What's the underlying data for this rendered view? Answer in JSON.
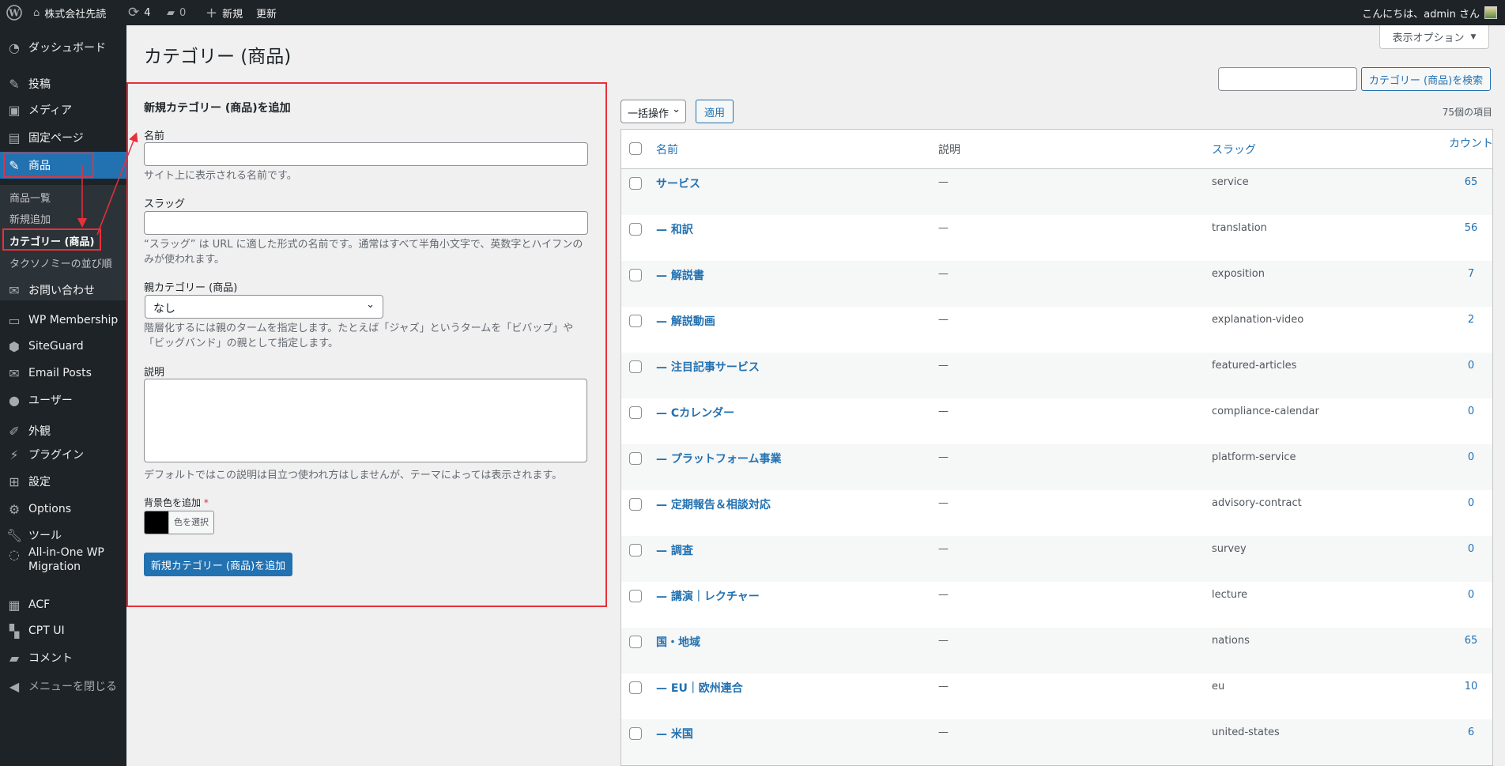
{
  "topbar": {
    "site_name": "株式会社先読",
    "updates": "4",
    "comments": "0",
    "new_label": "新規",
    "update_label": "更新",
    "greeting": "こんにちは、admin さん"
  },
  "sidebar": {
    "items": [
      {
        "label": "ダッシュボード",
        "icon": "dashboard-icon"
      },
      {
        "label": "投稿",
        "icon": "pin-icon"
      },
      {
        "label": "メディア",
        "icon": "media-icon"
      },
      {
        "label": "固定ページ",
        "icon": "pages-icon"
      },
      {
        "label": "商品",
        "icon": "pin-icon"
      },
      {
        "label": "お問い合わせ",
        "icon": "mail-icon"
      },
      {
        "label": "WP Membership",
        "icon": "id-card-icon"
      },
      {
        "label": "SiteGuard",
        "icon": "shield-icon"
      },
      {
        "label": "Email Posts",
        "icon": "envelope-icon"
      },
      {
        "label": "ユーザー",
        "icon": "user-icon"
      },
      {
        "label": "外観",
        "icon": "brush-icon"
      },
      {
        "label": "プラグイン",
        "icon": "plugin-icon"
      },
      {
        "label": "設定",
        "icon": "settings-icon"
      },
      {
        "label": "Options",
        "icon": "gear-icon"
      },
      {
        "label": "ツール",
        "icon": "wrench-icon"
      },
      {
        "label": "All-in-One WP Migration",
        "icon": "migration-icon"
      },
      {
        "label": "ACF",
        "icon": "acf-icon"
      },
      {
        "label": "CPT UI",
        "icon": "cpt-icon"
      },
      {
        "label": "コメント",
        "icon": "comment-icon"
      },
      {
        "label": "メニューを閉じる",
        "icon": "collapse-icon"
      }
    ],
    "submenu": [
      "商品一覧",
      "新規追加",
      "カテゴリー (商品)",
      "タクソノミーの並び順"
    ]
  },
  "page": {
    "title": "カテゴリー (商品)",
    "screen_options": "表示オプション"
  },
  "form": {
    "heading": "新規カテゴリー (商品)を追加",
    "name_label": "名前",
    "name_value": "",
    "name_help": "サイト上に表示される名前です。",
    "slug_label": "スラッグ",
    "slug_value": "",
    "slug_help_1": "“スラッグ” は URL に適した形式の名前です。通常はすべて半角小文字で、英数字とハイフンの",
    "slug_help_2": "みが使われます。",
    "parent_label": "親カテゴリー (商品)",
    "parent_value": "なし",
    "parent_help_1": "階層化するには親のタームを指定します。たとえば「ジャズ」というタームを「ビバップ」や",
    "parent_help_2": "「ビッグバンド」の親として指定します。",
    "desc_label": "説明",
    "desc_help": "デフォルトではこの説明は目立つ使われ方はしませんが、テーマによっては表示されます。",
    "color_label": "背景色を追加",
    "required": "*",
    "color_value": "#000000",
    "color_button": "色を選択",
    "submit": "新規カテゴリー (商品)を追加"
  },
  "list": {
    "search_value": "",
    "search_button": "カテゴリー (商品)を検索",
    "bulk_action": "一括操作",
    "apply": "適用",
    "item_count": "75個の項目",
    "headers": {
      "name": "名前",
      "description": "説明",
      "slug": "スラッグ",
      "count": "カウント"
    },
    "rows": [
      {
        "name": "サービス",
        "description": "—",
        "slug": "service",
        "count": "65"
      },
      {
        "name": "— 和訳",
        "description": "—",
        "slug": "translation",
        "count": "56"
      },
      {
        "name": "— 解説書",
        "description": "—",
        "slug": "exposition",
        "count": "7"
      },
      {
        "name": "— 解説動画",
        "description": "—",
        "slug": "explanation-video",
        "count": "2"
      },
      {
        "name": "— 注目記事サービス",
        "description": "—",
        "slug": "featured-articles",
        "count": "0"
      },
      {
        "name": "— Cカレンダー",
        "description": "—",
        "slug": "compliance-calendar",
        "count": "0"
      },
      {
        "name": "— プラットフォーム事業",
        "description": "—",
        "slug": "platform-service",
        "count": "0"
      },
      {
        "name": "— 定期報告＆相談対応",
        "description": "—",
        "slug": "advisory-contract",
        "count": "0"
      },
      {
        "name": "— 調査",
        "description": "—",
        "slug": "survey",
        "count": "0"
      },
      {
        "name": "— 講演｜レクチャー",
        "description": "—",
        "slug": "lecture",
        "count": "0"
      },
      {
        "name": "国・地域",
        "description": "—",
        "slug": "nations",
        "count": "65"
      },
      {
        "name": "— EU｜欧州連合",
        "description": "—",
        "slug": "eu",
        "count": "10"
      },
      {
        "name": "— 米国",
        "description": "—",
        "slug": "united-states",
        "count": "6"
      }
    ]
  },
  "colors": {
    "accent": "#2271b1",
    "annotation": "#e8303a",
    "sidebar": "#1d2327"
  }
}
